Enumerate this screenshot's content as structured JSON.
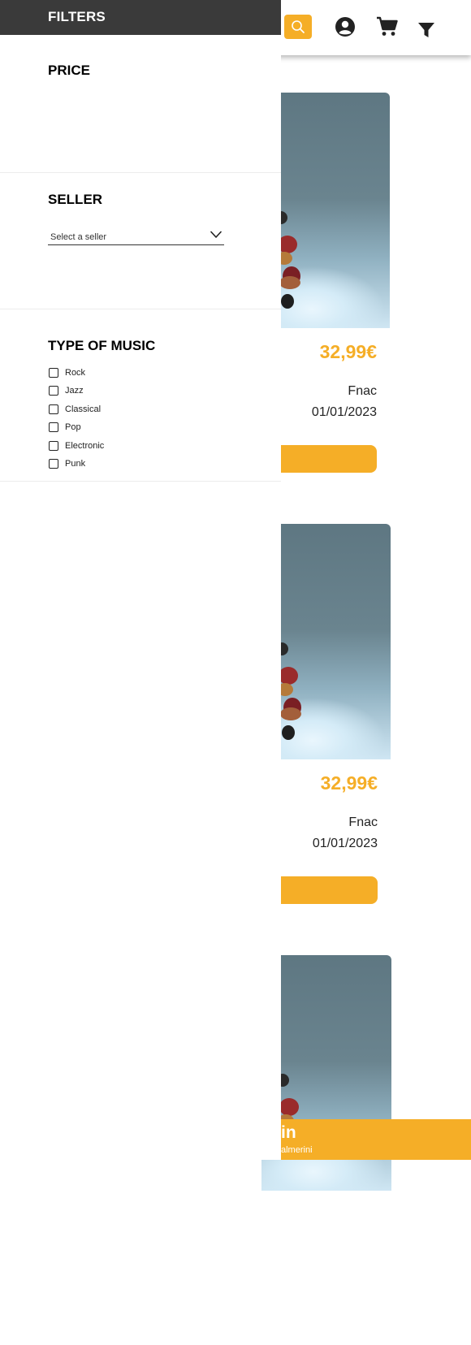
{
  "filters": {
    "title": "FILTERS",
    "price_title": "PRICE",
    "seller_title": "SELLER",
    "seller_placeholder": "Select a seller",
    "music_title": "TYPE OF MUSIC",
    "music_types": [
      "Rock",
      "Jazz",
      "Classical",
      "Pop",
      "Electronic",
      "Punk"
    ]
  },
  "topbar": {
    "icons": [
      "search-icon",
      "user-icon",
      "cart-icon",
      "filter-icon"
    ]
  },
  "cards": [
    {
      "price": "32,99€",
      "seller": "Fnac",
      "date": "01/01/2023"
    },
    {
      "price": "32,99€",
      "seller": "Fnac",
      "date": "01/01/2023"
    }
  ],
  "footer": {
    "title_fragment": "in",
    "subtitle_fragment": "almerini"
  },
  "colors": {
    "accent": "#f5ae27",
    "drawer_header": "#3a3a3a"
  }
}
